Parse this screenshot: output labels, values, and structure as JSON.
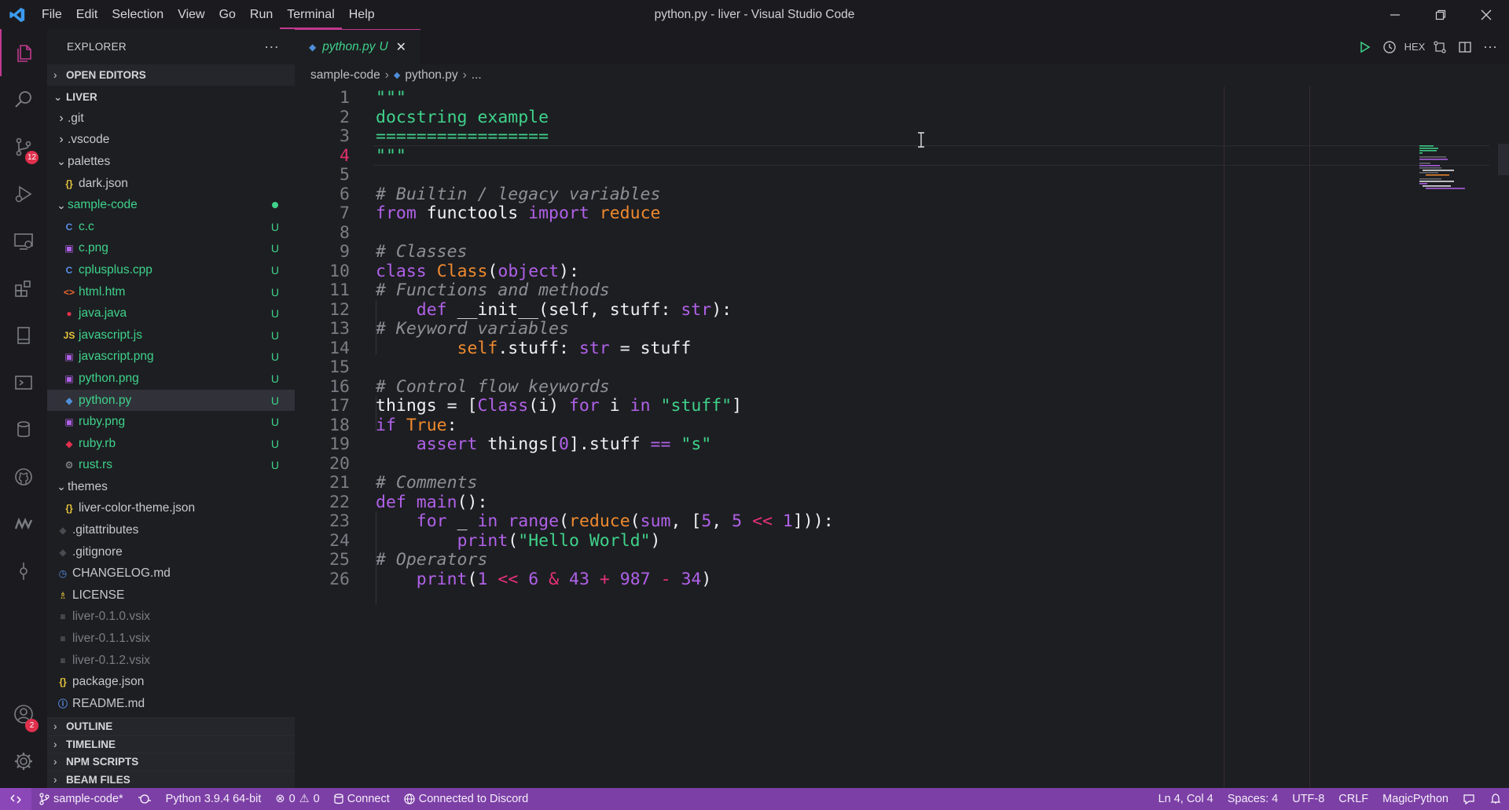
{
  "window": {
    "title": "python.py - liver - Visual Studio Code",
    "menu": [
      "File",
      "Edit",
      "Selection",
      "View",
      "Go",
      "Run",
      "Terminal",
      "Help"
    ],
    "active_menu": "Terminal"
  },
  "activity": {
    "scm_badge": "12",
    "accounts_badge": "2"
  },
  "explorer": {
    "title": "EXPLORER",
    "more": "···",
    "open_editors": "OPEN EDITORS",
    "root": "LIVER",
    "items": [
      {
        "label": ".git",
        "type": "folder",
        "open": false,
        "depth": 1,
        "color": "#c7c7cc"
      },
      {
        "label": ".vscode",
        "type": "folder",
        "open": false,
        "depth": 1,
        "color": "#c7c7cc"
      },
      {
        "label": "palettes",
        "type": "folder",
        "open": true,
        "depth": 1,
        "color": "#c7c7cc"
      },
      {
        "label": "dark.json",
        "type": "file",
        "icon": "{}",
        "icon_color": "#e8c73a",
        "depth": 2,
        "color": "#c7c7cc"
      },
      {
        "label": "sample-code",
        "type": "folder",
        "open": true,
        "depth": 1,
        "color": "#3fd28a",
        "dot": true
      },
      {
        "label": "c.c",
        "type": "file",
        "icon": "C",
        "icon_color": "#5a8ee8",
        "depth": 2,
        "color": "#3fd28a",
        "status": "U"
      },
      {
        "label": "c.png",
        "type": "file",
        "icon": "▣",
        "icon_color": "#b061e8",
        "depth": 2,
        "color": "#3fd28a",
        "status": "U"
      },
      {
        "label": "cplusplus.cpp",
        "type": "file",
        "icon": "C",
        "icon_color": "#5a8ee8",
        "depth": 2,
        "color": "#3fd28a",
        "status": "U"
      },
      {
        "label": "html.htm",
        "type": "file",
        "icon": "<>",
        "icon_color": "#ef6a2e",
        "depth": 2,
        "color": "#3fd28a",
        "status": "U"
      },
      {
        "label": "java.java",
        "type": "file",
        "icon": "●",
        "icon_color": "#e0304d",
        "depth": 2,
        "color": "#3fd28a",
        "status": "U"
      },
      {
        "label": "javascript.js",
        "type": "file",
        "icon": "JS",
        "icon_color": "#e8c73a",
        "depth": 2,
        "color": "#3fd28a",
        "status": "U"
      },
      {
        "label": "javascript.png",
        "type": "file",
        "icon": "▣",
        "icon_color": "#b061e8",
        "depth": 2,
        "color": "#3fd28a",
        "status": "U"
      },
      {
        "label": "python.png",
        "type": "file",
        "icon": "▣",
        "icon_color": "#b061e8",
        "depth": 2,
        "color": "#3fd28a",
        "status": "U"
      },
      {
        "label": "python.py",
        "type": "file",
        "icon": "◆",
        "icon_color": "#4f8ed8",
        "depth": 2,
        "color": "#3fd28a",
        "status": "U",
        "selected": true
      },
      {
        "label": "ruby.png",
        "type": "file",
        "icon": "▣",
        "icon_color": "#b061e8",
        "depth": 2,
        "color": "#3fd28a",
        "status": "U"
      },
      {
        "label": "ruby.rb",
        "type": "file",
        "icon": "◆",
        "icon_color": "#e0304d",
        "depth": 2,
        "color": "#3fd28a",
        "status": "U"
      },
      {
        "label": "rust.rs",
        "type": "file",
        "icon": "⚙",
        "icon_color": "#9a9aa0",
        "depth": 2,
        "color": "#3fd28a",
        "status": "U"
      },
      {
        "label": "themes",
        "type": "folder",
        "open": true,
        "depth": 1,
        "color": "#c7c7cc"
      },
      {
        "label": "liver-color-theme.json",
        "type": "file",
        "icon": "{}",
        "icon_color": "#e8c73a",
        "depth": 2,
        "color": "#c7c7cc"
      },
      {
        "label": ".gitattributes",
        "type": "file",
        "icon": "◆",
        "icon_color": "#4a4b52",
        "depth": 1,
        "color": "#c7c7cc"
      },
      {
        "label": ".gitignore",
        "type": "file",
        "icon": "◆",
        "icon_color": "#4a4b52",
        "depth": 1,
        "color": "#c7c7cc"
      },
      {
        "label": "CHANGELOG.md",
        "type": "file",
        "icon": "◷",
        "icon_color": "#5a8ee8",
        "depth": 1,
        "color": "#c7c7cc"
      },
      {
        "label": "LICENSE",
        "type": "file",
        "icon": "♗",
        "icon_color": "#e8c73a",
        "depth": 1,
        "color": "#c7c7cc"
      },
      {
        "label": "liver-0.1.0.vsix",
        "type": "file",
        "icon": "≡",
        "icon_color": "#7c7c84",
        "depth": 1,
        "color": "#7c7c84"
      },
      {
        "label": "liver-0.1.1.vsix",
        "type": "file",
        "icon": "≡",
        "icon_color": "#7c7c84",
        "depth": 1,
        "color": "#7c7c84"
      },
      {
        "label": "liver-0.1.2.vsix",
        "type": "file",
        "icon": "≡",
        "icon_color": "#7c7c84",
        "depth": 1,
        "color": "#7c7c84"
      },
      {
        "label": "package.json",
        "type": "file",
        "icon": "{}",
        "icon_color": "#e8c73a",
        "depth": 1,
        "color": "#c7c7cc"
      },
      {
        "label": "README.md",
        "type": "file",
        "icon": "ⓘ",
        "icon_color": "#5a8ee8",
        "depth": 1,
        "color": "#c7c7cc"
      }
    ],
    "bottom_sections": [
      "OUTLINE",
      "TIMELINE",
      "NPM SCRIPTS",
      "BEAM FILES"
    ]
  },
  "editor": {
    "tab": {
      "label": "python.py",
      "mark": "U"
    },
    "breadcrumb": [
      "sample-code",
      "python.py",
      "..."
    ],
    "tab_actions": {
      "hex": "HEX"
    },
    "current_line": 4,
    "lines": [
      [
        [
          "\"\"\"",
          "g"
        ]
      ],
      [
        [
          "docstring example",
          "g"
        ]
      ],
      [
        [
          "=================",
          "g"
        ]
      ],
      [
        [
          "\"\"\"",
          "g"
        ]
      ],
      [],
      [
        [
          "# Builtin / legacy variables",
          "c"
        ]
      ],
      [
        [
          "from",
          "k"
        ],
        [
          " functools ",
          "w"
        ],
        [
          "import",
          "k"
        ],
        [
          " reduce",
          "f"
        ]
      ],
      [],
      [
        [
          "# Classes",
          "c"
        ]
      ],
      [
        [
          "class",
          "k"
        ],
        [
          " ",
          "w"
        ],
        [
          "Class",
          "f"
        ],
        [
          "(",
          "w"
        ],
        [
          "object",
          "k"
        ],
        [
          "):",
          "w"
        ]
      ],
      [
        [
          "# Functions and methods",
          "c"
        ]
      ],
      [
        [
          "    ",
          "w"
        ],
        [
          "def",
          "k"
        ],
        [
          " __init__(self, stuff: ",
          "w"
        ],
        [
          "str",
          "k"
        ],
        [
          "):",
          "w"
        ]
      ],
      [
        [
          "# Keyword variables",
          "c"
        ]
      ],
      [
        [
          "        ",
          "w"
        ],
        [
          "self",
          "f"
        ],
        [
          ".stuff: ",
          "w"
        ],
        [
          "str",
          "k"
        ],
        [
          " = stuff",
          "w"
        ]
      ],
      [],
      [
        [
          "# Control flow keywords",
          "c"
        ]
      ],
      [
        [
          "things = [",
          "w"
        ],
        [
          "Class",
          "k"
        ],
        [
          "(i) ",
          "w"
        ],
        [
          "for",
          "k"
        ],
        [
          " i ",
          "w"
        ],
        [
          "in",
          "k"
        ],
        [
          " ",
          "w"
        ],
        [
          "\"stuff\"",
          "g"
        ],
        [
          "]",
          "w"
        ]
      ],
      [
        [
          "if",
          "k"
        ],
        [
          " ",
          "w"
        ],
        [
          "True",
          "f"
        ],
        [
          ":",
          "w"
        ]
      ],
      [
        [
          "    ",
          "w"
        ],
        [
          "assert",
          "k"
        ],
        [
          " things[",
          "w"
        ],
        [
          "0",
          "n"
        ],
        [
          "].stuff ",
          "w"
        ],
        [
          "==",
          "k"
        ],
        [
          " ",
          "w"
        ],
        [
          "\"s\"",
          "g"
        ]
      ],
      [],
      [
        [
          "# Comments",
          "c"
        ]
      ],
      [
        [
          "def",
          "k"
        ],
        [
          " ",
          "w"
        ],
        [
          "main",
          "k"
        ],
        [
          "():",
          "w"
        ]
      ],
      [
        [
          "    ",
          "w"
        ],
        [
          "for",
          "k"
        ],
        [
          " _ ",
          "w"
        ],
        [
          "in",
          "k"
        ],
        [
          " ",
          "w"
        ],
        [
          "range",
          "k"
        ],
        [
          "(",
          "w"
        ],
        [
          "reduce",
          "f"
        ],
        [
          "(",
          "w"
        ],
        [
          "sum",
          "k"
        ],
        [
          ", [",
          "w"
        ],
        [
          "5",
          "n"
        ],
        [
          ", ",
          "w"
        ],
        [
          "5",
          "n"
        ],
        [
          " ",
          "w"
        ],
        [
          "<<",
          "y"
        ],
        [
          " ",
          "w"
        ],
        [
          "1",
          "n"
        ],
        [
          "])):",
          "w"
        ]
      ],
      [
        [
          "        ",
          "w"
        ],
        [
          "print",
          "k"
        ],
        [
          "(",
          "w"
        ],
        [
          "\"Hello World\"",
          "g"
        ],
        [
          ")",
          "w"
        ]
      ],
      [
        [
          "# Operators",
          "c"
        ]
      ],
      [
        [
          "    ",
          "w"
        ],
        [
          "print",
          "k"
        ],
        [
          "(",
          "w"
        ],
        [
          "1",
          "n"
        ],
        [
          " ",
          "w"
        ],
        [
          "<<",
          "y"
        ],
        [
          " ",
          "w"
        ],
        [
          "6",
          "n"
        ],
        [
          " ",
          "w"
        ],
        [
          "&",
          "y"
        ],
        [
          " ",
          "w"
        ],
        [
          "43",
          "n"
        ],
        [
          " ",
          "w"
        ],
        [
          "+",
          "y"
        ],
        [
          " ",
          "w"
        ],
        [
          "987",
          "n"
        ],
        [
          " ",
          "w"
        ],
        [
          "-",
          "y"
        ],
        [
          " ",
          "w"
        ],
        [
          "34",
          "n"
        ],
        [
          ")",
          "w"
        ]
      ]
    ]
  },
  "status": {
    "branch": "sample-code*",
    "python": "Python 3.9.4 64-bit",
    "errors": "0",
    "warnings": "0",
    "connect": "Connect",
    "discord": "Connected to Discord",
    "position": "Ln 4, Col 4",
    "spaces": "Spaces: 4",
    "encoding": "UTF-8",
    "eol": "CRLF",
    "language": "MagicPython"
  },
  "colors": {
    "accent": "#c1398f",
    "statusbar": "#7c3fa6",
    "untracked": "#3fd28a"
  }
}
